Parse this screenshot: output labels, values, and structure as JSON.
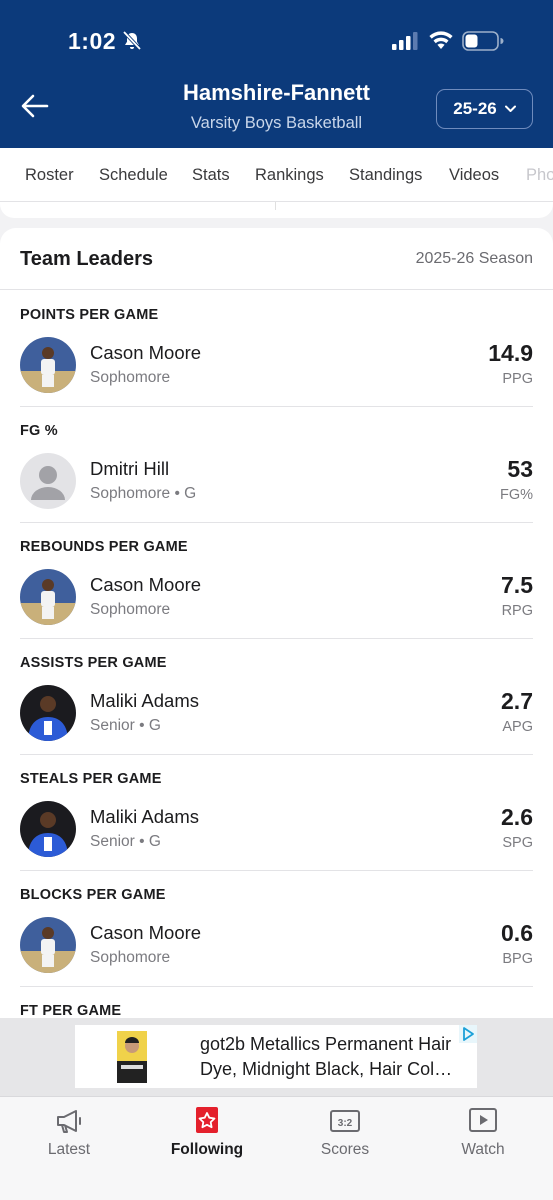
{
  "status": {
    "time": "1:02"
  },
  "header": {
    "title": "Hamshire-Fannett",
    "subtitle": "Varsity Boys Basketball",
    "season_select": "25-26"
  },
  "tabs": [
    "Roster",
    "Schedule",
    "Stats",
    "Rankings",
    "Standings",
    "Videos",
    "Pho"
  ],
  "team_leaders": {
    "title": "Team Leaders",
    "season": "2025-26 Season",
    "sections": [
      {
        "label": "POINTS PER GAME",
        "player": "Cason Moore",
        "detail": "Sophomore",
        "value": "14.9",
        "unit": "PPG"
      },
      {
        "label": "FG %",
        "player": "Dmitri Hill",
        "detail": "Sophomore • G",
        "value": "53",
        "unit": "FG%"
      },
      {
        "label": "REBOUNDS PER GAME",
        "player": "Cason Moore",
        "detail": "Sophomore",
        "value": "7.5",
        "unit": "RPG"
      },
      {
        "label": "ASSISTS PER GAME",
        "player": "Maliki Adams",
        "detail": "Senior • G",
        "value": "2.7",
        "unit": "APG"
      },
      {
        "label": "STEALS PER GAME",
        "player": "Maliki Adams",
        "detail": "Senior • G",
        "value": "2.6",
        "unit": "SPG"
      },
      {
        "label": "BLOCKS PER GAME",
        "player": "Cason Moore",
        "detail": "Sophomore",
        "value": "0.6",
        "unit": "BPG"
      },
      {
        "label": "FT PER GAME"
      }
    ]
  },
  "ad": {
    "text": "got2b Metallics Permanent Hair Dye, Midnight Black, Hair Col…"
  },
  "bottom_nav": [
    {
      "label": "Latest",
      "icon": "megaphone-icon"
    },
    {
      "label": "Following",
      "icon": "star-icon"
    },
    {
      "label": "Scores",
      "icon": "scoreboard-icon"
    },
    {
      "label": "Watch",
      "icon": "play-icon"
    }
  ],
  "colors": {
    "header_bg": "#0c3a7b",
    "following_red": "#e4202c"
  }
}
